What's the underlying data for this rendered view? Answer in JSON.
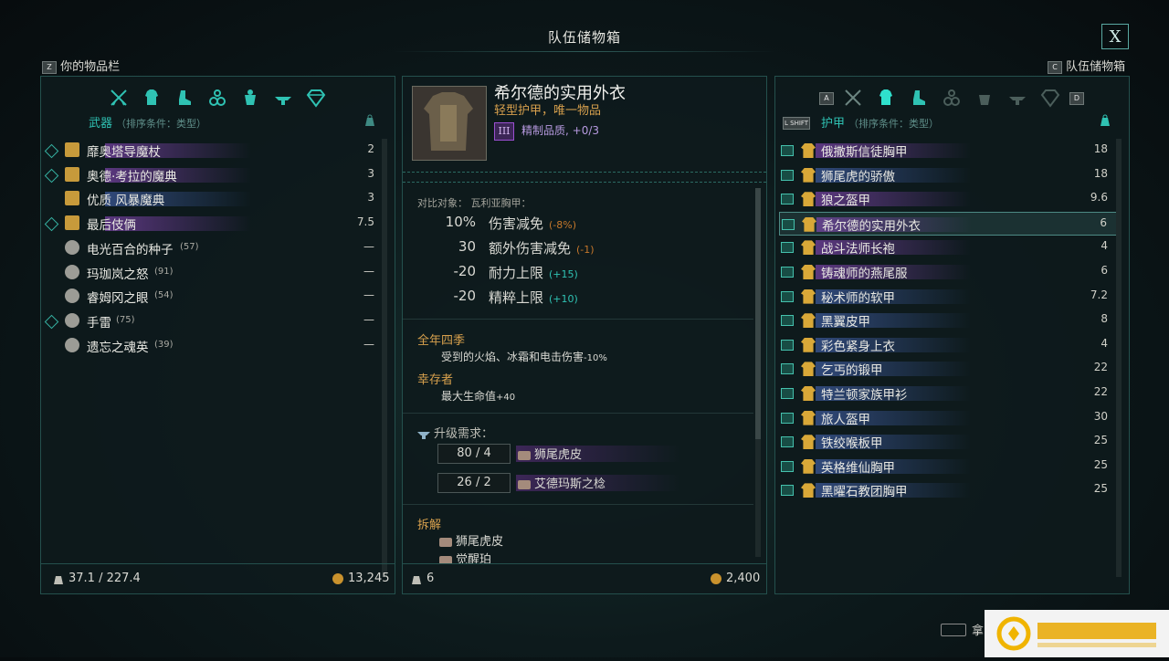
{
  "title": "队伍储物箱",
  "close_label": "X",
  "left_header": {
    "key": "Z",
    "label": "你的物品栏"
  },
  "right_header": {
    "key": "C",
    "label": "队伍储物箱"
  },
  "left_panel": {
    "category": "武器",
    "sort": "（排序条件：类型）",
    "items": [
      {
        "name": "靡奥塔导魔杖",
        "value": "2",
        "fav": true,
        "color": "#9a4fd1"
      },
      {
        "name": "奥德·考拉的魔典",
        "value": "3",
        "fav": true,
        "color": "#9a4fd1"
      },
      {
        "name": "优质 风暴魔典",
        "value": "3",
        "fav": false,
        "color": "#4c6fc7"
      },
      {
        "name": "最后伎俩",
        "value": "7.5",
        "fav": true,
        "color": "#9a4fd1"
      },
      {
        "name": "电光百合的种子",
        "count": "(57)",
        "value": "—",
        "fav": false,
        "color": ""
      },
      {
        "name": "玛珈岚之怒",
        "count": "(91)",
        "value": "—",
        "fav": false,
        "color": ""
      },
      {
        "name": "睿姆冈之眼",
        "count": "(54)",
        "value": "—",
        "fav": false,
        "color": ""
      },
      {
        "name": "手雷",
        "count": "(75)",
        "value": "—",
        "fav": true,
        "color": ""
      },
      {
        "name": "遗忘之魂英",
        "count": "(39)",
        "value": "—",
        "fav": false,
        "color": ""
      }
    ],
    "weight": "37.1 / 227.4",
    "gold": "13,245"
  },
  "detail": {
    "name": "希尔德的实用外衣",
    "subtitle": "轻型护甲，唯一物品",
    "tier": "III",
    "quality": "精制品质",
    "quality_extra": "+0/3",
    "compare": "对比对象：   瓦利亚胸甲：",
    "stats": [
      {
        "num": "10%",
        "name": "伤害减免",
        "diff": "(-8%)",
        "pos": false
      },
      {
        "num": "30",
        "name": "额外伤害减免",
        "diff": "(-1)",
        "pos": false
      },
      {
        "num": "-20",
        "name": "耐力上限",
        "diff": "(+15)",
        "pos": true
      },
      {
        "num": "-20",
        "name": "精粹上限",
        "diff": "(+10)",
        "pos": true
      }
    ],
    "perks": [
      {
        "title": "全年四季",
        "text": "受到的火焰、冰霜和电击伤害",
        "val": "-10%"
      },
      {
        "title": "幸存者",
        "text": "最大生命值",
        "val": "+40"
      }
    ],
    "upgrade_title": "升级需求：",
    "upgrade": [
      {
        "qty": "80 / 4",
        "mat": "狮尾虎皮"
      },
      {
        "qty": "26 / 2",
        "mat": "艾德玛斯之棯"
      }
    ],
    "dismantle_title": "拆解",
    "dismantle": [
      "狮尾虎皮",
      "觉醒珀"
    ],
    "weight": "6",
    "gold": "2,400"
  },
  "right_panel": {
    "key_a": "A",
    "key_d": "D",
    "key_shift": "L SHIFT",
    "category": "护甲",
    "sort": "（排序条件：类型）",
    "items": [
      {
        "name": "俄撒斯信徒胸甲",
        "value": "18",
        "color": "#9a4fd1"
      },
      {
        "name": "狮尾虎的骄傲",
        "value": "18",
        "color": "#4c6fc7"
      },
      {
        "name": "狼之盔甲",
        "value": "9.6",
        "color": "#9a4fd1"
      },
      {
        "name": "希尔德的实用外衣",
        "value": "6",
        "color": "#9a4fd1"
      },
      {
        "name": "战斗法师长袍",
        "value": "4",
        "color": "#9a4fd1"
      },
      {
        "name": "铸魂师的燕尾服",
        "value": "6",
        "color": "#9a4fd1"
      },
      {
        "name": "秘术师的软甲",
        "value": "7.2",
        "color": "#4c6fc7"
      },
      {
        "name": "黑翼皮甲",
        "value": "8",
        "color": "#4c6fc7"
      },
      {
        "name": "彩色紧身上衣",
        "value": "4",
        "color": "#4c6fc7"
      },
      {
        "name": "乞丐的锻甲",
        "value": "22",
        "color": "#4c6fc7"
      },
      {
        "name": "特兰顿家族甲衫",
        "value": "22",
        "color": "#4c6fc7"
      },
      {
        "name": "旅人盔甲",
        "value": "30",
        "color": "#4c6fc7"
      },
      {
        "name": "铁绞喉板甲",
        "value": "25",
        "color": "#4c6fc7"
      },
      {
        "name": "英格维仙胸甲",
        "value": "25",
        "color": "#4c6fc7"
      },
      {
        "name": "黑曜石教团胸甲",
        "value": "25",
        "color": "#4c6fc7"
      }
    ]
  },
  "bottom_hint": "拿"
}
